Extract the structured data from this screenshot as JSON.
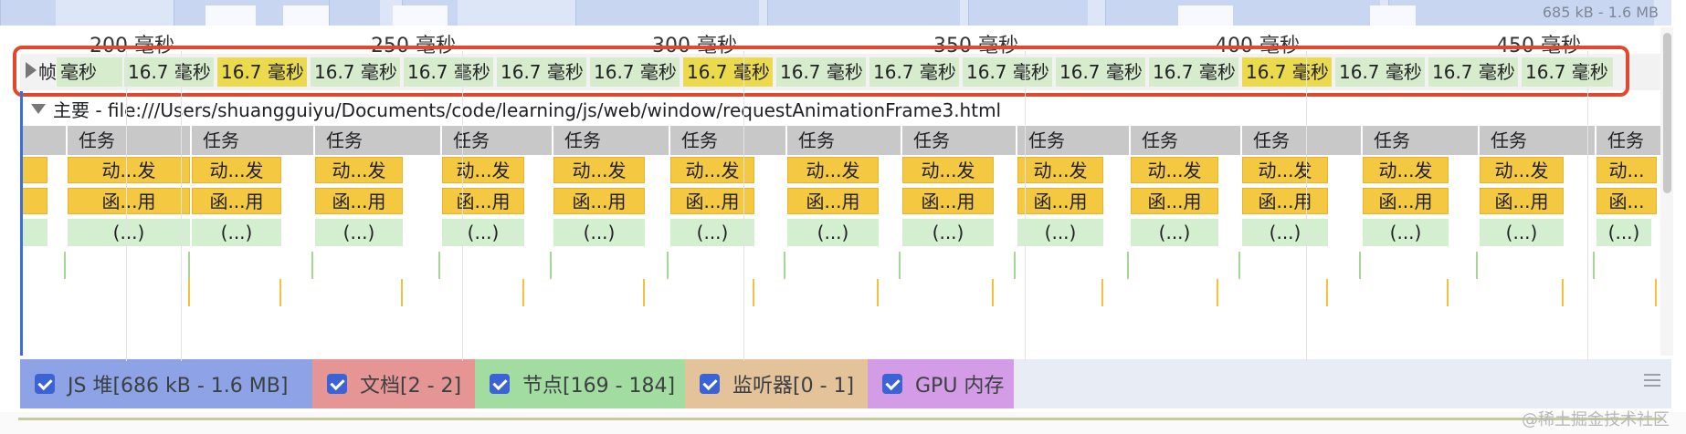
{
  "overview": {
    "memory_range": "685 kB - 1.6 MB"
  },
  "ruler": {
    "ticks": [
      "200 毫秒",
      "250 毫秒",
      "300 毫秒",
      "350 毫秒",
      "400 毫秒",
      "450 毫秒"
    ]
  },
  "frames": {
    "label": "帧",
    "first_cell": "毫秒",
    "cells": [
      {
        "text": "16.7 毫秒",
        "state": "normal"
      },
      {
        "text": "16.7 毫秒",
        "state": "highlight"
      },
      {
        "text": "16.7 毫秒",
        "state": "normal"
      },
      {
        "text": "16.7 毫秒",
        "state": "normal"
      },
      {
        "text": "16.7 毫秒",
        "state": "normal"
      },
      {
        "text": "16.7 毫秒",
        "state": "normal"
      },
      {
        "text": "16.7 毫秒",
        "state": "highlight"
      },
      {
        "text": "16.7 毫秒",
        "state": "normal"
      },
      {
        "text": "16.7 毫秒",
        "state": "normal"
      },
      {
        "text": "16.7 毫秒",
        "state": "normal"
      },
      {
        "text": "16.7 毫秒",
        "state": "normal"
      },
      {
        "text": "16.7 毫秒",
        "state": "normal"
      },
      {
        "text": "16.7 毫秒",
        "state": "highlight"
      },
      {
        "text": "16.7 毫秒",
        "state": "normal"
      },
      {
        "text": "16.7 毫秒",
        "state": "normal"
      },
      {
        "text": "16.7 毫秒",
        "state": "normal"
      }
    ],
    "highlight_color": "#ecda4d",
    "normal_color": "#d6eccc"
  },
  "main": {
    "title": "主要 - file:///Users/shuangguiyu/Documents/code/learning/js/web/window/requestAnimationFrame3.html",
    "task_label": "任务",
    "anim_label": "动...发",
    "anim_label_short": "动...",
    "func_label": "函...用",
    "func_label_short": "函...",
    "paren_label": "(...)"
  },
  "legend": {
    "items": [
      {
        "label": "JS 堆[686 kB - 1.6 MB]",
        "color": "#8da3e6",
        "checked": true
      },
      {
        "label": "文档[2 - 2]",
        "color": "#e69595",
        "checked": true
      },
      {
        "label": "节点[169 - 184]",
        "color": "#a3dca0",
        "checked": true
      },
      {
        "label": "监听器[0 - 1]",
        "color": "#e4c29a",
        "checked": true
      },
      {
        "label": "GPU 内存",
        "color": "#d49ce6",
        "checked": true
      }
    ]
  },
  "watermark": "@稀土掘金技术社区",
  "colors": {
    "accent": "#3b63d6",
    "highlight_border": "#e0492e",
    "task": "#c8c8c8",
    "script": "#f5c842",
    "paint": "#d4efcf"
  }
}
